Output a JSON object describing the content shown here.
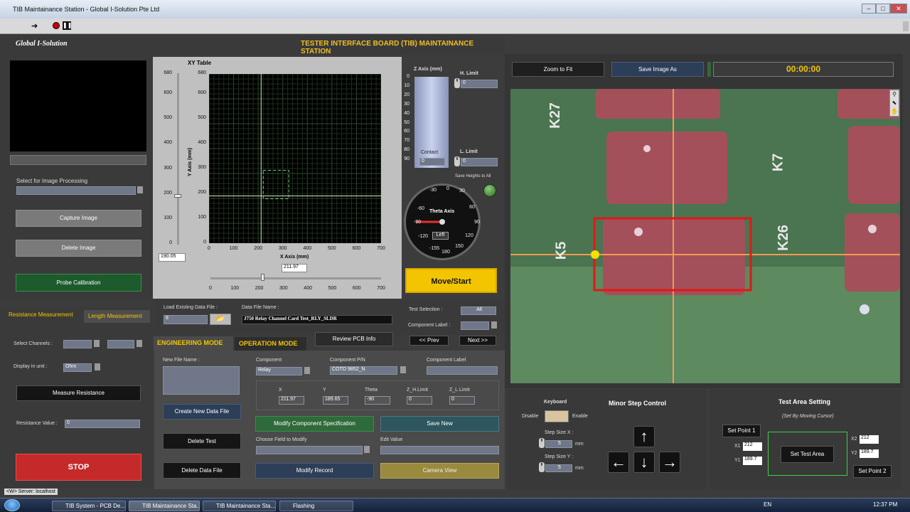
{
  "window": {
    "title": "TIB Maintainance Station - Global I-Solution Pte Ltd"
  },
  "header": {
    "brand": "Global I-Solution",
    "app_title": "TESTER INTERFACE BOARD (TIB) MAINTAINANCE STATION"
  },
  "left": {
    "select_image_label": "Select for Image Processing",
    "capture_label": "Capture Image",
    "delete_label": "Delete Image",
    "probe_label": "Probe Calibration",
    "tabs": [
      "Resistance Measurement",
      "Length Measurement"
    ],
    "select_channels_label": "Select Channels :",
    "display_unit_label": "Display in unit :",
    "display_unit_value": "Ohm",
    "measure_label": "Measure Resistance",
    "resistance_label": "Resistance Value :",
    "resistance_value": "0",
    "stop_label": "STOP"
  },
  "xy": {
    "title": "XY Table",
    "x_axis_label": "X Axis (mm)",
    "y_axis_label": "Y Axis (mm)",
    "x_ticks": [
      "0",
      "100",
      "200",
      "300",
      "400",
      "500",
      "600",
      "700"
    ],
    "y_ticks": [
      "680",
      "600",
      "500",
      "400",
      "300",
      "200",
      "100",
      "0"
    ],
    "y_slider_ticks": [
      "680",
      "600",
      "500",
      "400",
      "300",
      "200",
      "100",
      "0"
    ],
    "y_value": "190.05",
    "x_value": "211.97",
    "cursor": {
      "x": 211.97,
      "y": 190.05
    },
    "x_range": [
      0,
      700
    ],
    "y_range": [
      0,
      680
    ]
  },
  "z": {
    "title": "Z Axis (mm)",
    "ticks": [
      "0",
      "10",
      "20",
      "30",
      "40",
      "50",
      "60",
      "70",
      "80",
      "90"
    ],
    "contact_label": "Contact",
    "contact_value": "0",
    "h_limit_label": "H. Limit",
    "h_limit_value": "0",
    "l_limit_label": "L. Limit",
    "l_limit_value": "0",
    "save_heights_label": "Save Heights to All"
  },
  "theta": {
    "title": "Theta Axis",
    "labels": [
      "-30",
      "0",
      "30",
      "-60",
      "60",
      "-90",
      "90",
      "-120",
      "120",
      "-155",
      "150",
      "180"
    ],
    "value": "Left",
    "left_value": "90"
  },
  "move_start_label": "Move/Start",
  "file": {
    "load_label": "Load Existing Data File :",
    "load_value": "8",
    "name_label": "Data File Name :",
    "name_value": "J750 Relay Channel Card Test_RLY_SLDR",
    "review_label": "Review PCB Info",
    "test_selection_label": "Test Selection :",
    "test_selection_value": "All",
    "component_label_label": "Component Label :",
    "prev_label": "<< Prev",
    "next_label": "Next >>"
  },
  "modes": [
    "ENGINEERING MODE",
    "OPERATION MODE"
  ],
  "eng": {
    "new_file_label": "New File Name :",
    "create_label": "Create New Data File",
    "delete_test_label": "Delete Test",
    "delete_file_label": "Delete Data File",
    "component_label": "Component",
    "component_value": "Relay",
    "pn_label": "Component P/N",
    "pn_value": "COTO 9852_N",
    "comp_label_label": "Component Label",
    "coords": [
      {
        "label": "X",
        "value": "211.97"
      },
      {
        "label": "Y",
        "value": "189.65"
      },
      {
        "label": "Theta",
        "value": "-90"
      },
      {
        "label": "Z_H.Limit",
        "value": "0"
      },
      {
        "label": "Z_L.Limit",
        "value": "0"
      }
    ],
    "modify_spec_label": "Modify Component Specification",
    "save_new_label": "Save New",
    "choose_field_label": "Choose Field to Modify",
    "edit_value_label": "Edit Value",
    "modify_record_label": "Modify Record",
    "camera_view_label": "Camera View"
  },
  "camera": {
    "zoom_label": "Zoom to Fit",
    "save_label": "Save Image As",
    "timer": "00:00:00",
    "pcb_labels": [
      "K27",
      "K7",
      "K5",
      "K26"
    ]
  },
  "keyboard": {
    "title": "Keyboard",
    "disable": "Disable",
    "enable": "Enable"
  },
  "minor": {
    "title": "Minor Step Control",
    "step_x_label": "Step Size X :",
    "step_x_value": "5",
    "step_y_label": "Step Size Y :",
    "step_y_value": "5",
    "unit": "mm"
  },
  "test_area": {
    "title": "Test Area Setting",
    "subtitle": "(Set By Moving Cursor)",
    "set_point1": "Set Point 1",
    "set_point2": "Set Point 2",
    "set_area": "Set Test Area",
    "x1_label": "X1",
    "x1_value": "212",
    "y1_label": "Y1",
    "y1_value": "189.7",
    "x2_label": "X2",
    "x2_value": "212",
    "y2_label": "Y2",
    "y2_value": "189.7"
  },
  "status": {
    "server": "<W> Server: localhost"
  },
  "taskbar": {
    "items": [
      "TIB System - PCB De...",
      "TIB Maintainance Sta...",
      "TIB Maintainance Sta...",
      "Flashing"
    ],
    "lang": "EN",
    "time": "12:37 PM"
  },
  "colors": {
    "accent_yellow": "#f2c500",
    "stop_red": "#c42a2a",
    "title_gold": "#f0c020"
  }
}
